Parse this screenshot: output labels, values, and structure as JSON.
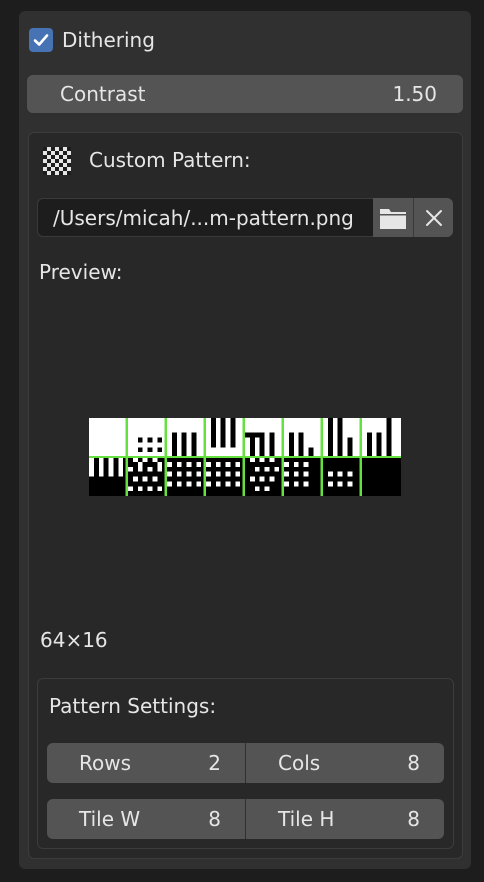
{
  "dithering": {
    "label": "Dithering",
    "checked": true
  },
  "contrast": {
    "label": "Contrast",
    "value": "1.50"
  },
  "custom_pattern": {
    "label": "Custom Pattern:",
    "path": "/Users/micah/...m-pattern.png",
    "icons": [
      "checker-pattern-icon",
      "folder-icon",
      "close-icon"
    ]
  },
  "preview": {
    "label": "Preview:",
    "size": "64×16"
  },
  "pattern_settings": {
    "label": "Pattern Settings:",
    "rows": {
      "label": "Rows",
      "value": "2"
    },
    "cols": {
      "label": "Cols",
      "value": "8"
    },
    "tile_w": {
      "label": "Tile W",
      "value": "8"
    },
    "tile_h": {
      "label": "Tile H",
      "value": "8"
    }
  },
  "colors": {
    "accent": "#4772b3",
    "grid": "#66e040"
  }
}
